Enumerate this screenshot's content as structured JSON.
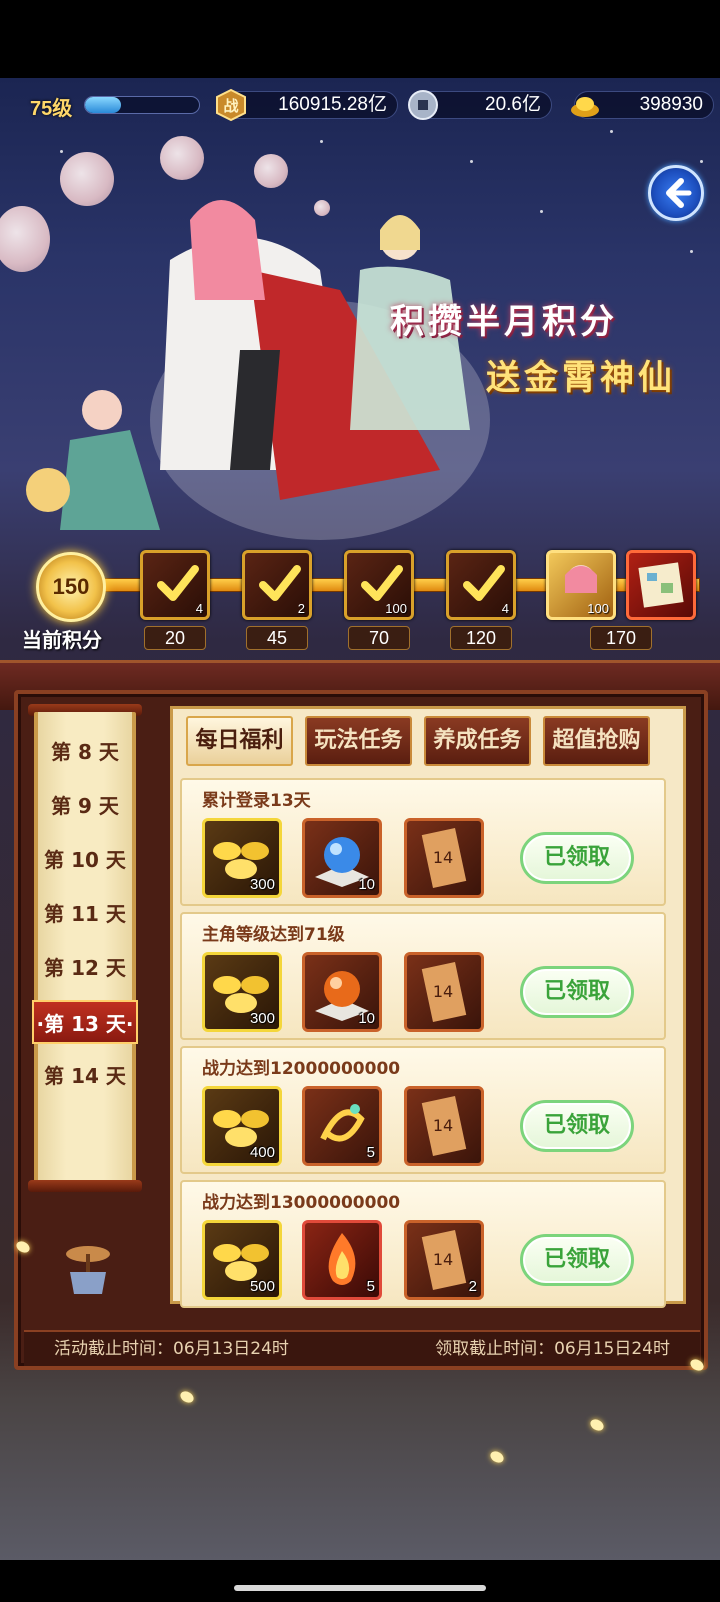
{
  "player": {
    "level_label": "75级",
    "xp_progress": 0.32
  },
  "resources": [
    {
      "name": "combat-power",
      "icon": "battle-power-icon",
      "value": "160915.28亿"
    },
    {
      "name": "silver-coin",
      "icon": "coin-icon",
      "value": "20.6亿"
    },
    {
      "name": "gold-ingot",
      "icon": "gold-ingot-icon",
      "value": "398930"
    }
  ],
  "banner": {
    "line1": "积攒半月积分",
    "line2": "送金霄神仙"
  },
  "progress": {
    "current_score": "150",
    "current_label": "当前积分",
    "milestones": [
      {
        "points": "20",
        "qty": "4",
        "claimed": true
      },
      {
        "points": "45",
        "qty": "2",
        "claimed": true
      },
      {
        "points": "70",
        "qty": "100",
        "claimed": true
      },
      {
        "points": "120",
        "qty": "4",
        "claimed": true
      },
      {
        "points": "",
        "qty": "100",
        "claimed": false
      },
      {
        "points": "170",
        "qty": "",
        "claimed": false
      }
    ]
  },
  "days": {
    "items": [
      "第 8 天",
      "第 9 天",
      "第 10 天",
      "第 11 天",
      "第 12 天",
      "·第 13 天·",
      "第 14 天"
    ],
    "active_index": 5
  },
  "tabs": [
    {
      "label": "每日福利",
      "active": true
    },
    {
      "label": "玩法任务",
      "active": false
    },
    {
      "label": "养成任务",
      "active": false
    },
    {
      "label": "超值抢购",
      "active": false
    }
  ],
  "tasks": [
    {
      "title": "累计登录13天",
      "rewards": [
        {
          "icon": "gold-ingot-pile-icon",
          "qty": "300",
          "frame": "yellow"
        },
        {
          "icon": "blue-orb-icon",
          "qty": "10",
          "frame": "orange"
        },
        {
          "icon": "ticket-14-icon",
          "qty": "",
          "frame": "orange"
        }
      ],
      "status": "已领取"
    },
    {
      "title": "主角等级达到71级",
      "rewards": [
        {
          "icon": "gold-ingot-pile-icon",
          "qty": "300",
          "frame": "yellow"
        },
        {
          "icon": "orange-orb-icon",
          "qty": "10",
          "frame": "orange"
        },
        {
          "icon": "ticket-14-icon",
          "qty": "",
          "frame": "orange"
        }
      ],
      "status": "已领取"
    },
    {
      "title": "战力达到12000000000",
      "rewards": [
        {
          "icon": "gold-ingot-pile-icon",
          "qty": "400",
          "frame": "yellow"
        },
        {
          "icon": "golden-swirl-icon",
          "qty": "5",
          "frame": "orange"
        },
        {
          "icon": "ticket-14-icon",
          "qty": "",
          "frame": "orange"
        }
      ],
      "status": "已领取"
    },
    {
      "title": "战力达到13000000000",
      "rewards": [
        {
          "icon": "gold-ingot-pile-icon",
          "qty": "500",
          "frame": "yellow"
        },
        {
          "icon": "red-flame-icon",
          "qty": "5",
          "frame": "red"
        },
        {
          "icon": "ticket-14-icon",
          "qty": "2",
          "frame": "orange"
        }
      ],
      "status": "已领取"
    }
  ],
  "deadlines": {
    "activity_end": "活动截止时间：06月13日24时",
    "claim_end": "领取截止时间：06月15日24时"
  },
  "colors": {
    "accent_gold": "#f2c24a",
    "claimed_green": "#3aa33a",
    "wood": "#4a1e14"
  }
}
